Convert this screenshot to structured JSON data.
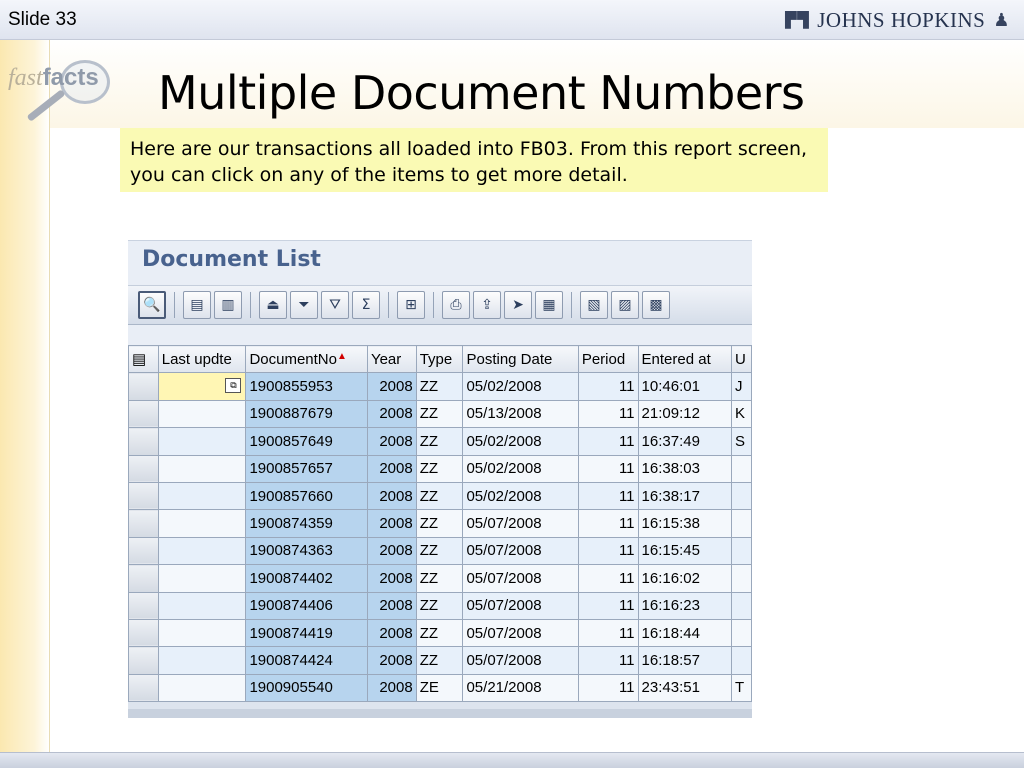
{
  "header": {
    "slide_label": "Slide 33",
    "logo_text": "JOHNS HOPKINS"
  },
  "branding": {
    "fast": "fast",
    "facts": "facts"
  },
  "title": "Multiple Document Numbers",
  "note": "Here are our transactions all loaded into FB03. From this report screen, you can click on any of the items to get more detail.",
  "sap": {
    "window_title": "Document List",
    "toolbar": [
      {
        "icon": "details-icon",
        "glyph": "🔍"
      },
      {
        "icon": "select-all-icon",
        "glyph": "▤"
      },
      {
        "icon": "deselect-all-icon",
        "glyph": "▥"
      },
      {
        "icon": "sort-ascending-icon",
        "glyph": "⏏"
      },
      {
        "icon": "sort-descending-icon",
        "glyph": "⏷"
      },
      {
        "icon": "filter-icon",
        "glyph": "⛛"
      },
      {
        "icon": "total-icon",
        "glyph": "Σ"
      },
      {
        "icon": "subtotal-icon",
        "glyph": "⊞"
      },
      {
        "icon": "print-icon",
        "glyph": "⎙"
      },
      {
        "icon": "export-icon",
        "glyph": "⇪"
      },
      {
        "icon": "send-icon",
        "glyph": "➤"
      },
      {
        "icon": "spreadsheet-icon",
        "glyph": "▦"
      },
      {
        "icon": "layout-change-icon",
        "glyph": "▧"
      },
      {
        "icon": "layout-select-icon",
        "glyph": "▨"
      },
      {
        "icon": "layout-save-icon",
        "glyph": "▩"
      }
    ],
    "columns": [
      "Last updte",
      "DocumentNo",
      "Year",
      "Type",
      "Posting Date",
      "Period",
      "Entered at",
      "U"
    ],
    "rows": [
      {
        "last": "",
        "doc": "1900855953",
        "year": "2008",
        "type": "ZZ",
        "posting": "05/02/2008",
        "period": "11",
        "entered": "10:46:01",
        "u": "J"
      },
      {
        "last": "",
        "doc": "1900887679",
        "year": "2008",
        "type": "ZZ",
        "posting": "05/13/2008",
        "period": "11",
        "entered": "21:09:12",
        "u": "K"
      },
      {
        "last": "",
        "doc": "1900857649",
        "year": "2008",
        "type": "ZZ",
        "posting": "05/02/2008",
        "period": "11",
        "entered": "16:37:49",
        "u": "S"
      },
      {
        "last": "",
        "doc": "1900857657",
        "year": "2008",
        "type": "ZZ",
        "posting": "05/02/2008",
        "period": "11",
        "entered": "16:38:03",
        "u": ""
      },
      {
        "last": "",
        "doc": "1900857660",
        "year": "2008",
        "type": "ZZ",
        "posting": "05/02/2008",
        "period": "11",
        "entered": "16:38:17",
        "u": ""
      },
      {
        "last": "",
        "doc": "1900874359",
        "year": "2008",
        "type": "ZZ",
        "posting": "05/07/2008",
        "period": "11",
        "entered": "16:15:38",
        "u": ""
      },
      {
        "last": "",
        "doc": "1900874363",
        "year": "2008",
        "type": "ZZ",
        "posting": "05/07/2008",
        "period": "11",
        "entered": "16:15:45",
        "u": ""
      },
      {
        "last": "",
        "doc": "1900874402",
        "year": "2008",
        "type": "ZZ",
        "posting": "05/07/2008",
        "period": "11",
        "entered": "16:16:02",
        "u": ""
      },
      {
        "last": "",
        "doc": "1900874406",
        "year": "2008",
        "type": "ZZ",
        "posting": "05/07/2008",
        "period": "11",
        "entered": "16:16:23",
        "u": ""
      },
      {
        "last": "",
        "doc": "1900874419",
        "year": "2008",
        "type": "ZZ",
        "posting": "05/07/2008",
        "period": "11",
        "entered": "16:18:44",
        "u": ""
      },
      {
        "last": "",
        "doc": "1900874424",
        "year": "2008",
        "type": "ZZ",
        "posting": "05/07/2008",
        "period": "11",
        "entered": "16:18:57",
        "u": ""
      },
      {
        "last": "",
        "doc": "1900905540",
        "year": "2008",
        "type": "ZE",
        "posting": "05/21/2008",
        "period": "11",
        "entered": "23:43:51",
        "u": "T"
      }
    ]
  }
}
